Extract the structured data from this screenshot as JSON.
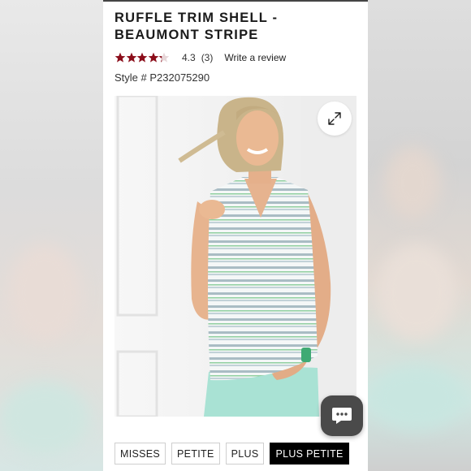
{
  "product": {
    "title_line1": "RUFFLE TRIM SHELL -",
    "title_line2": "BEAUMONT STRIPE",
    "rating": {
      "stars": 4.3,
      "value_label": "4.3",
      "count_label": "(3)",
      "write_review_label": "Write a review",
      "star_color": "#8b0d1a"
    },
    "style_label": "Style # P232075290"
  },
  "gallery": {
    "expand_icon": "expand-arrows-icon"
  },
  "chat": {
    "icon": "chat-bubble-icon"
  },
  "sizes": {
    "options": [
      "MISSES",
      "PETITE",
      "PLUS",
      "PLUS PETITE"
    ],
    "selected": "PLUS PETITE"
  }
}
